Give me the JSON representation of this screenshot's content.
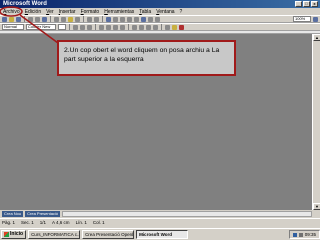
{
  "window": {
    "title": "Microsoft Word",
    "buttons": [
      "_",
      "□",
      "x"
    ]
  },
  "menu": {
    "items": [
      "Archivo",
      "Edición",
      "Ver",
      "Insertar",
      "Formato",
      "Herramientas",
      "Tabla",
      "Ventana",
      "?"
    ]
  },
  "toolbar2": {
    "style_value": "Normal",
    "font_value": "Courier New",
    "zoom_value": "100%"
  },
  "callout": {
    "text": "2.Un cop obert el word cliquem on posa archiu a La part superior a la esquerra",
    "border_color": "#a01a1a"
  },
  "taskpanes": {
    "tab1": "Crea Nou",
    "tab2": "Crea Presentació"
  },
  "status": {
    "page": "Pàg. 1",
    "section": "Sec. 1",
    "pages": "1/1",
    "at": "A 4,6 cm",
    "line": "Lín. 1",
    "col": "Col. 1"
  },
  "taskbar": {
    "start": "Inicio",
    "tasks": [
      "Curs_INFORMATICA c...",
      "Crea Presentació Openb...",
      "Microsoft Word"
    ],
    "clock": "09:35"
  }
}
